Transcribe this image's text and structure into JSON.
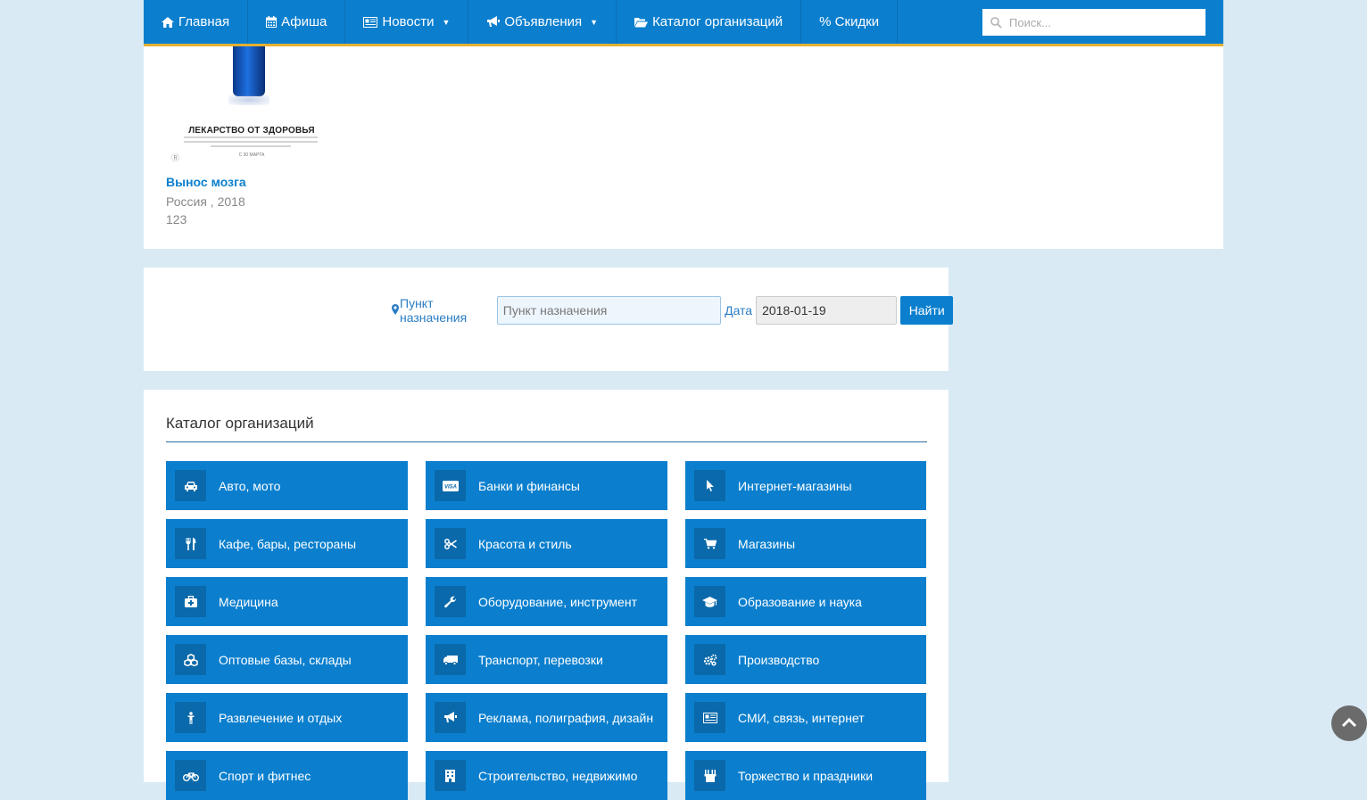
{
  "nav": {
    "items": [
      {
        "label": "Главная",
        "icon": "home-icon"
      },
      {
        "label": "Афиша",
        "icon": "calendar-icon"
      },
      {
        "label": "Новости",
        "icon": "newspaper-icon",
        "dropdown": true
      },
      {
        "label": "Объявления",
        "icon": "bullhorn-icon",
        "dropdown": true
      },
      {
        "label": "Каталог организаций",
        "icon": "folder-open-icon"
      },
      {
        "label": "% Скидки",
        "icon": ""
      }
    ],
    "search_placeholder": "Поиск..."
  },
  "movie": {
    "poster_title": "ЛЕКАРСТВО ОТ ЗДОРОВЬЯ",
    "poster_date": "С 30 МАРТА",
    "title": "Вынос мозга",
    "meta_line1": "Россия , 2018",
    "meta_line2": "123"
  },
  "destination": {
    "label": "Пункт назначения",
    "placeholder": "Пункт назначения",
    "date_label": "Дата",
    "date_value": "2018-01-19",
    "button": "Найти"
  },
  "catalog": {
    "title": "Каталог организаций",
    "items": [
      {
        "label": "Авто, мото",
        "icon": "car-icon"
      },
      {
        "label": "Банки и финансы",
        "icon": "credit-card-icon"
      },
      {
        "label": "Интернет-магазины",
        "icon": "cursor-icon"
      },
      {
        "label": "Кафе, бары, рестораны",
        "icon": "cutlery-icon"
      },
      {
        "label": "Красота и стиль",
        "icon": "scissors-icon"
      },
      {
        "label": "Магазины",
        "icon": "shopping-cart-icon"
      },
      {
        "label": "Медицина",
        "icon": "medkit-icon"
      },
      {
        "label": "Оборудование, инструмент",
        "icon": "wrench-icon"
      },
      {
        "label": "Образование и наука",
        "icon": "graduation-cap-icon"
      },
      {
        "label": "Оптовые базы, склады",
        "icon": "cubes-icon"
      },
      {
        "label": "Транспорт, перевозки",
        "icon": "truck-icon"
      },
      {
        "label": "Производство",
        "icon": "cogs-icon"
      },
      {
        "label": "Развлечение и отдых",
        "icon": "person-icon"
      },
      {
        "label": "Реклама, полиграфия, дизайн",
        "icon": "bullhorn-icon"
      },
      {
        "label": "СМИ, связь, интернет",
        "icon": "newspaper-icon"
      },
      {
        "label": "Спорт и фитнес",
        "icon": "bicycle-icon"
      },
      {
        "label": "Строительство, недвижимо",
        "icon": "building-icon"
      },
      {
        "label": "Торжество и праздники",
        "icon": "glass-icon"
      }
    ]
  },
  "colors": {
    "primary": "#0b7fce",
    "accent": "#e3b032",
    "background": "#d9eaf4"
  }
}
